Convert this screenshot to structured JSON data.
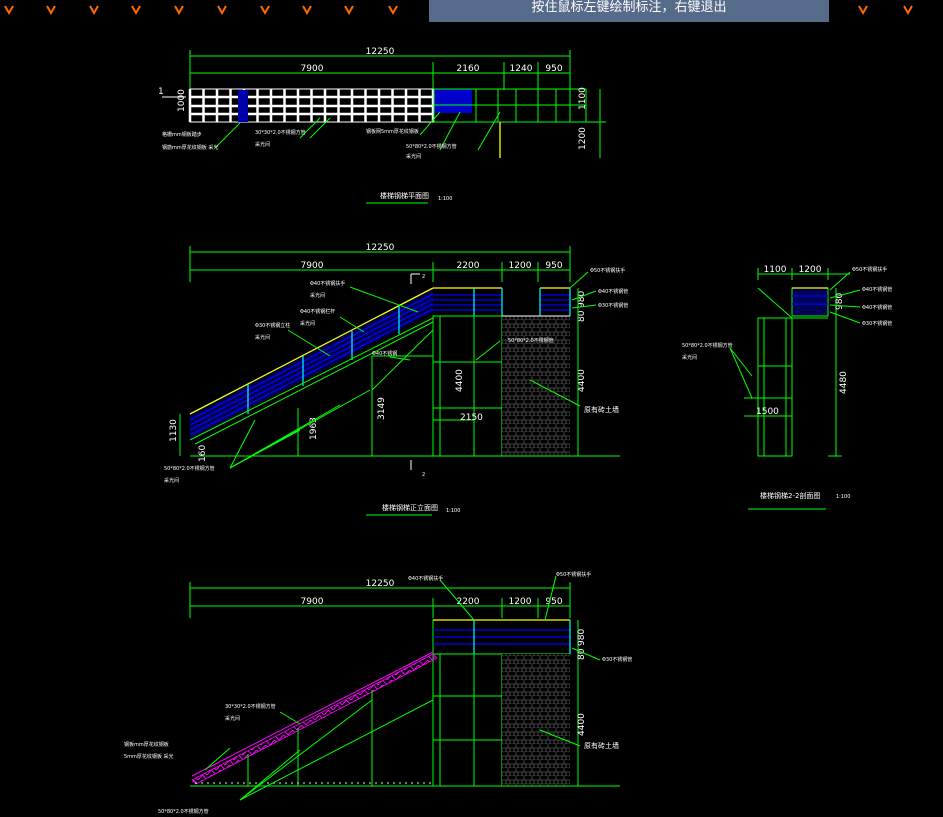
{
  "status_tip": "按住鼠标左键绘制标注，右键退出",
  "colors": {
    "background": "#000000",
    "tip_bg": "#566a89",
    "dim": "#00ff00",
    "steel": "#0000ff",
    "rail": "#ffff00",
    "marker": "#ff6600"
  },
  "plan": {
    "dims": {
      "total": "12250",
      "a": "7900",
      "b": "2160",
      "c": "1240",
      "d": "950",
      "left": "1000",
      "right1": "1100",
      "right2": "1200"
    },
    "sec_mark": "1",
    "notes": [
      "格栅mm钢板踏步",
      "钢筋mm厚花纹钢板 采光",
      "30*30*2.0不锈钢方管",
      "采光间",
      "钢板网5mm厚花纹钢板",
      "50*80*2.0不锈钢方管",
      "采光间"
    ],
    "title": "楼梯钢梯平面图",
    "scale": "1:100"
  },
  "elev": {
    "dims": {
      "total": "12250",
      "a": "7900",
      "b": "2200",
      "c": "1200",
      "d": "950",
      "h1": "1130",
      "h2": "1963",
      "h3": "3149",
      "h4": "4400",
      "h5": "4400",
      "h6": "980",
      "h7": "80",
      "w": "2150",
      "s": "160"
    },
    "sec_mark": "2",
    "notes": [
      "Φ40不锈钢扶手",
      "采光间",
      "Φ40不锈钢栏杆",
      "采光间",
      "Φ30不锈钢立柱",
      "采光间",
      "Φ40不锈钢",
      "50*80*2.0不锈钢管",
      "Φ50不锈钢扶手",
      "Φ40不锈钢管",
      "Φ30不锈钢管",
      "50*80*2.0不锈钢方管",
      "采光间",
      "原有砖土墙"
    ],
    "title": "楼梯钢梯正立面图",
    "scale": "1:100"
  },
  "section": {
    "dims": {
      "a": "1100",
      "b": "1200",
      "h": "4480",
      "h2": "980",
      "w": "1500"
    },
    "notes": [
      "Φ50不锈钢扶手",
      "Φ40不锈钢管",
      "Φ40不锈钢管",
      "Φ30不锈钢管",
      "50*80*2.0不锈钢方管",
      "采光间"
    ],
    "title": "楼梯钢梯2-2剖面图",
    "scale": "1:100"
  },
  "elev2": {
    "dims": {
      "total": "12250",
      "a": "7900",
      "b": "2200",
      "c": "1200",
      "d": "950",
      "h1": "80",
      "h2": "980",
      "h3": "4400"
    },
    "notes": [
      "Φ40不锈钢扶手",
      "Φ50不锈钢扶手",
      "Φ30不锈钢管",
      "30*30*2.0不锈钢方管",
      "采光间",
      "钢板mm厚花纹钢板",
      "5mm厚花纹钢板 采光",
      "50*80*2.0不锈钢方管",
      "原有砖土墙"
    ]
  }
}
